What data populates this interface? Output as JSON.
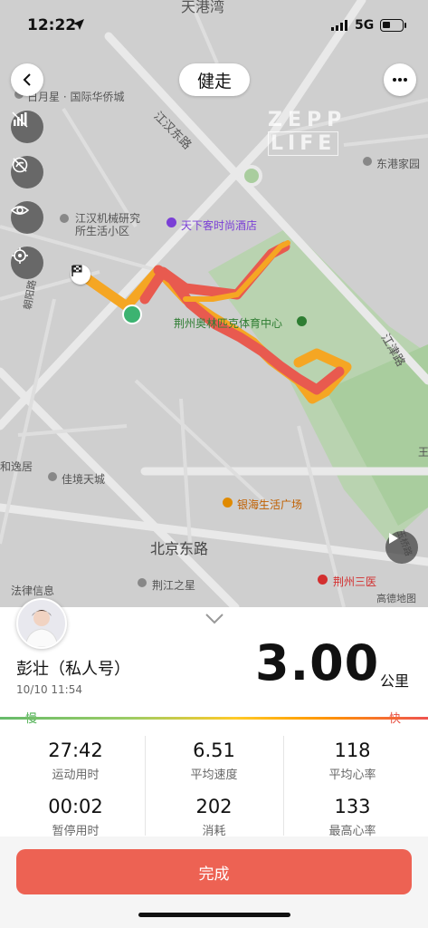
{
  "status_bar": {
    "time": "12:22",
    "network": "5G"
  },
  "header": {
    "title": "健走"
  },
  "map": {
    "watermark_brand": "ZEPP",
    "watermark_sub": "LIFE",
    "labels": {
      "top_partial": "天港湾",
      "riyuexing": "日月星 · 国际华侨城",
      "jianggang_road": "江汉东路",
      "donggang": "东港家园",
      "jianghan_machine": "江汉机械研究",
      "jianghan_machine_2": "所生活小区",
      "hotel": "天下客时尚酒店",
      "sports_center": "荆州奥林匹克体育中心",
      "jiangjin_road": "江津路",
      "chaoyang_road": "朝阳路",
      "heyiju": "和逸居",
      "jiajing": "佳境天城",
      "yinhai": "银海生活广场",
      "beijing_road": "北京东路",
      "legal": "法律信息",
      "jingjiang_star": "荆江之星",
      "jingzhou_hospital": "荆州三医",
      "gaode": "高德地图",
      "yumin_road": "玉桥路",
      "wang": "王"
    }
  },
  "profile": {
    "name": "彭壮（私人号）",
    "date": "10/10 11:54"
  },
  "summary": {
    "distance": "3.00",
    "unit": "公里",
    "slow_label": "慢",
    "fast_label": "快"
  },
  "stats": [
    {
      "value": "27:42",
      "label": "运动用时"
    },
    {
      "value": "6.51",
      "label": "平均速度"
    },
    {
      "value": "118",
      "label": "平均心率"
    },
    {
      "value": "00:02",
      "label": "暂停用时"
    },
    {
      "value": "202",
      "label": "消耗"
    },
    {
      "value": "133",
      "label": "最高心率"
    }
  ],
  "actions": {
    "done": "完成"
  },
  "colors": {
    "accent": "#ed6253",
    "route_slow": "#f5a623",
    "route_fast": "#e85a4f",
    "start": "#3cb371"
  },
  "icons": [
    "back-icon",
    "more-icon",
    "heatmap-toggle-icon",
    "hide-route-icon",
    "eye-icon",
    "locate-icon",
    "play-icon",
    "chevron-down-icon",
    "finish-flag-icon",
    "start-point-icon"
  ]
}
